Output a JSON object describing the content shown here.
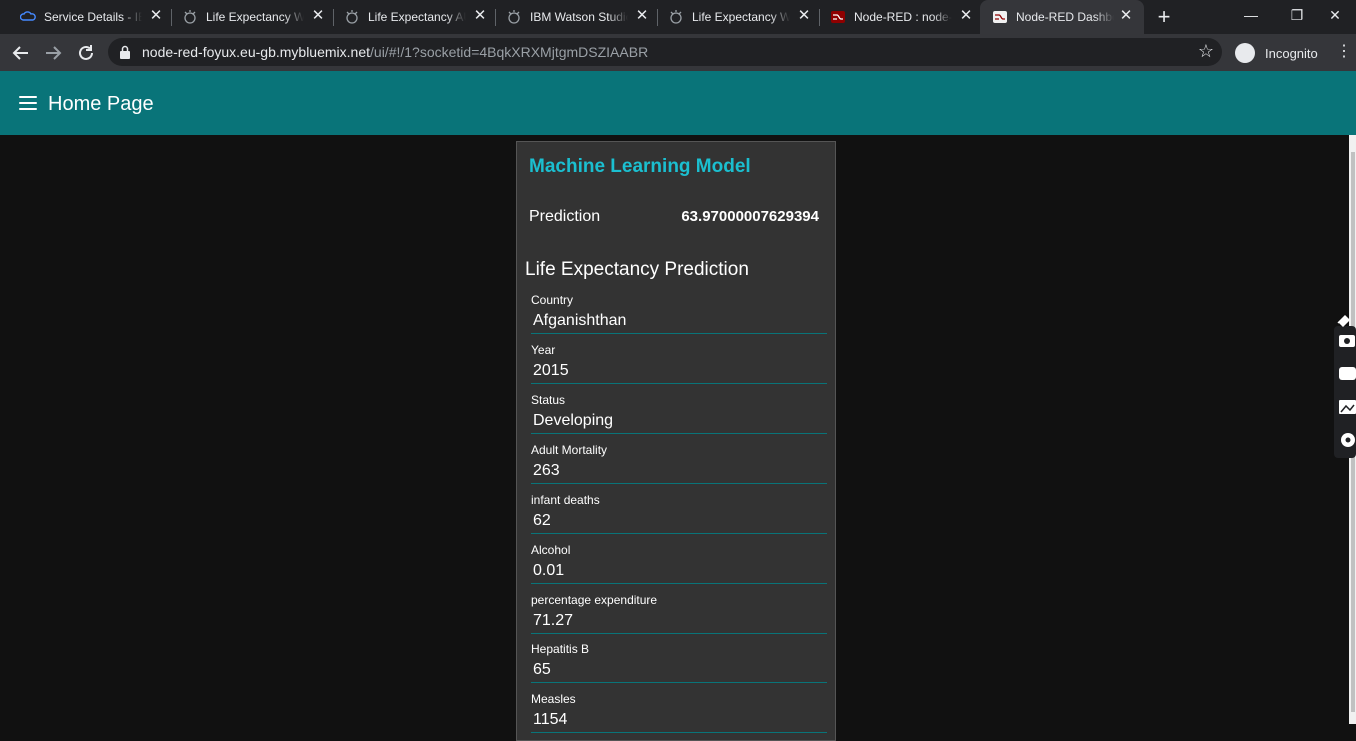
{
  "browser": {
    "tabs": [
      {
        "title": "Service Details - IBM Cloud",
        "icon": "ibm-cloud-icon",
        "active": false
      },
      {
        "title": "Life Expectancy Wk",
        "icon": "watson-icon",
        "active": false
      },
      {
        "title": "Life Expectancy AU",
        "icon": "watson-icon",
        "active": false
      },
      {
        "title": "IBM Watson Studio",
        "icon": "watson-icon",
        "active": false
      },
      {
        "title": "Life Expectancy Wk",
        "icon": "watson-icon",
        "active": false
      },
      {
        "title": "Node-RED : node-red",
        "icon": "node-red-icon",
        "active": false
      },
      {
        "title": "Node-RED Dashboard",
        "icon": "node-red-icon",
        "active": true
      }
    ],
    "url_host": "node-red-foyux.eu-gb.mybluemix.net",
    "url_rest": "/ui/#!/1?socketid=4BqkXRXMjtgmDSZIAABR",
    "incognito_label": "Incognito"
  },
  "app": {
    "title": "Home Page",
    "card_title": "Machine Learning Model",
    "prediction_label": "Prediction",
    "prediction_value": "63.97000007629394",
    "form_title": "Life Expectancy Prediction",
    "fields": [
      {
        "label": "Country",
        "value": "Afganishthan"
      },
      {
        "label": "Year",
        "value": "2015"
      },
      {
        "label": "Status",
        "value": "Developing"
      },
      {
        "label": "Adult Mortality",
        "value": "263"
      },
      {
        "label": "infant deaths",
        "value": "62"
      },
      {
        "label": "Alcohol",
        "value": "0.01"
      },
      {
        "label": "percentage expenditure",
        "value": "71.27"
      },
      {
        "label": "Hepatitis B",
        "value": "65"
      },
      {
        "label": "Measles",
        "value": "1154"
      }
    ]
  },
  "colors": {
    "appbar": "#097479",
    "accent_title": "#1bbfd0",
    "page_bg": "#111111",
    "card_bg": "#333333"
  }
}
